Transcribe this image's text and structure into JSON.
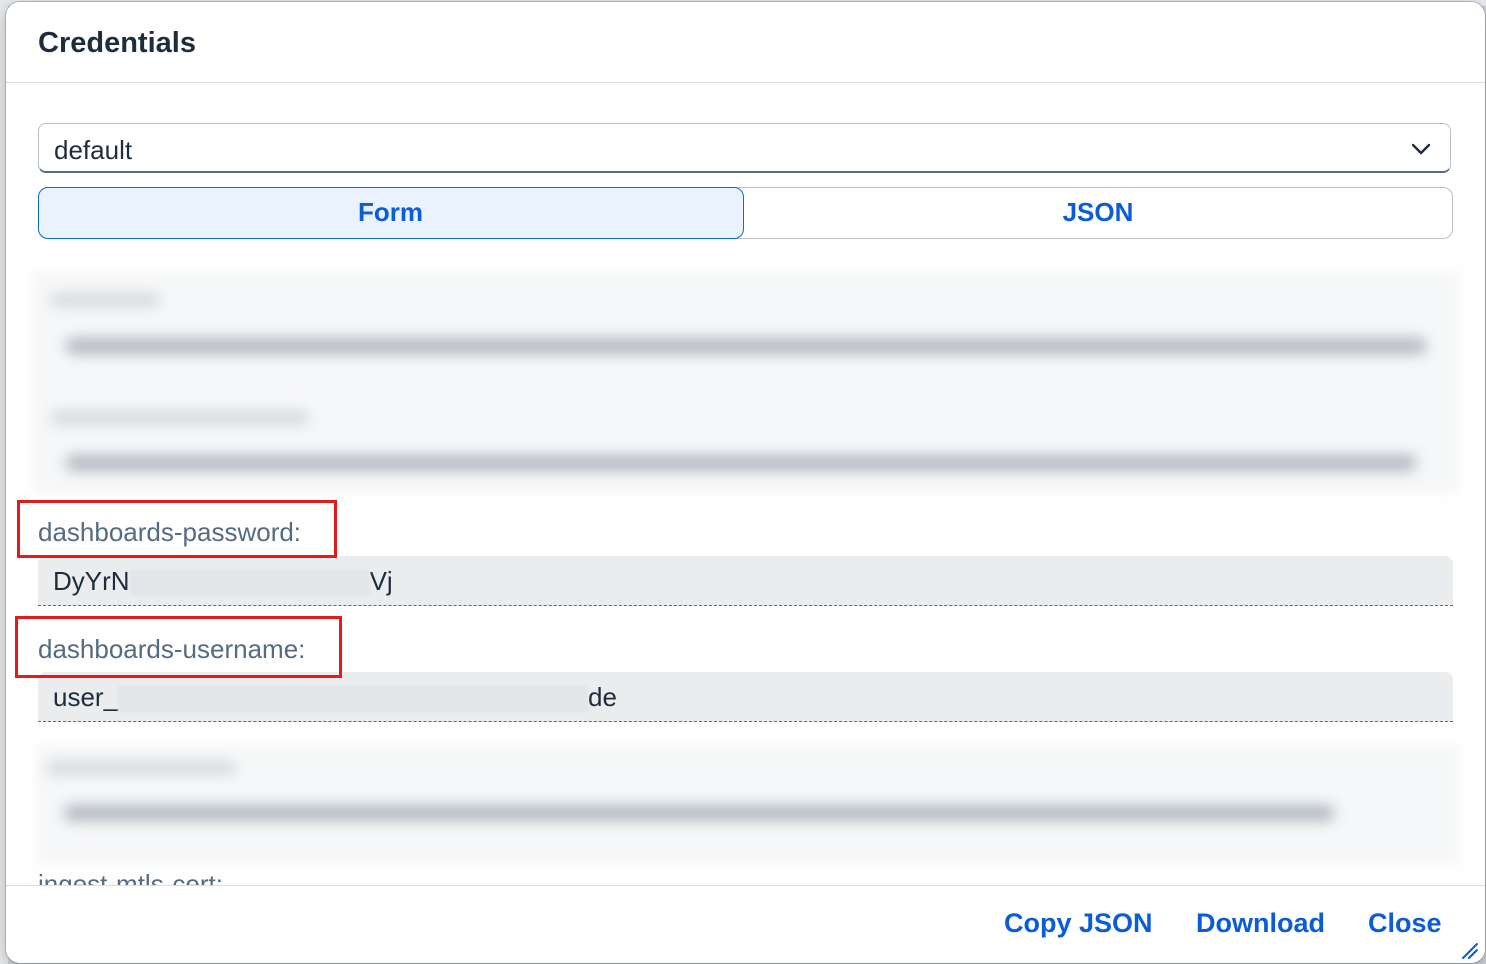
{
  "dialog": {
    "title": "Credentials"
  },
  "instance_select": {
    "value": "default",
    "icon": "chevron-down-icon"
  },
  "view_toggle": {
    "form_label": "Form",
    "json_label": "JSON",
    "selected": "Form"
  },
  "fields": [
    {
      "label": "dashboards-password:",
      "value_prefix": "DyYrN",
      "value_suffix": "Vj"
    },
    {
      "label": "dashboards-username:",
      "value_prefix": "user_",
      "value_suffix": "de"
    }
  ],
  "partial_label": "ingest-mtls-cert:",
  "footer": {
    "copy_json": "Copy JSON",
    "download": "Download",
    "close": "Close"
  },
  "colors": {
    "accent": "#0a5dd6",
    "highlight": "#e31b1b",
    "label": "#556b82"
  }
}
